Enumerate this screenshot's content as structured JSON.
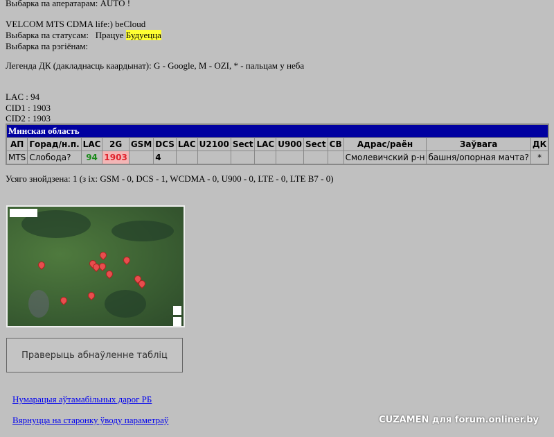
{
  "filter_operators": "Выбарка па аператарам: AUTO !",
  "operators": "VELCOM MTS CDMA life:) beCloud",
  "status_label": "Выбарка па статусам:",
  "status_working": "Працуе",
  "status_future": "Будуецца",
  "region_filter": "Выбарка па рэгіёнам:",
  "legend": "Легенда ДК (дакладнасць каардынат): G - Google, M - OZI, * - пальцам у неба",
  "lac": "LAC  : 94",
  "cid1": "CID1 : 1903",
  "cid2": "CID2 : 1903",
  "table": {
    "region": "Минская область",
    "headers": [
      "АП",
      "Горад/н.п.",
      "LAC",
      "2G",
      "GSM",
      "DCS",
      "LAC",
      "U2100",
      "Sect",
      "LAC",
      "U900",
      "Sect",
      "CB",
      "Адрас/раён",
      "Заўвага",
      "ДК"
    ],
    "rows": [
      [
        "MTS",
        "Слобода?",
        "94",
        "1903",
        "",
        "4",
        "",
        "",
        "",
        "",
        "",
        "",
        "",
        "Смолевичский р-н",
        "башня/опорная мачта?",
        "*"
      ]
    ]
  },
  "total": "Усяго знойдзена: 1 (з іх: GSM - 0, DCS - 1, WCDMA - 0, U900 - 0, LTE - 0, LTE B7 - 0)",
  "check_button": "Праверыць абнаўленне табліц",
  "links": [
    "Нумарацыя аўтамабільных дарог РБ",
    "Вярнуцца на старонку ўводу параметраў"
  ],
  "watermark": "CUZAMEN для forum.onliner.by"
}
